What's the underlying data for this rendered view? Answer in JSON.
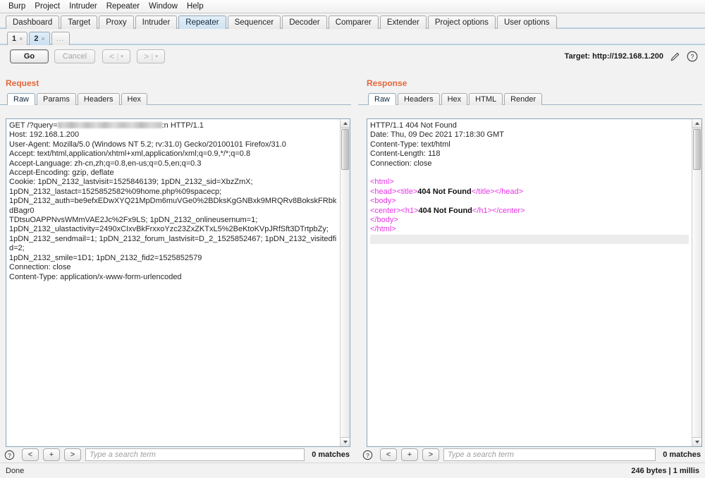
{
  "menubar": {
    "items": [
      "Burp",
      "Project",
      "Intruder",
      "Repeater",
      "Window",
      "Help"
    ]
  },
  "main_tabs": {
    "items": [
      "Dashboard",
      "Target",
      "Proxy",
      "Intruder",
      "Repeater",
      "Sequencer",
      "Decoder",
      "Comparer",
      "Extender",
      "Project options",
      "User options"
    ],
    "selected": "Repeater"
  },
  "repeater_tabs": {
    "items": [
      {
        "label": "1",
        "close": "×",
        "selected": false
      },
      {
        "label": "2",
        "close": "×",
        "selected": true
      },
      {
        "label": "...",
        "close": "",
        "selected": false
      }
    ]
  },
  "toolbar": {
    "go_label": "Go",
    "cancel_label": "Cancel",
    "back_label": "<",
    "forward_label": ">",
    "caret": "▾",
    "separator": "|",
    "target_label": "Target: http://192.168.1.200",
    "pencil_icon": "pencil-icon",
    "help_icon": "help-icon"
  },
  "request": {
    "title": "Request",
    "tabs": [
      "Raw",
      "Params",
      "Headers",
      "Hex"
    ],
    "selected_tab": "Raw",
    "lines": [
      {
        "prefix": "GET /?query=",
        "redacted": true,
        "suffix": ":n HTTP/1.1"
      },
      {
        "text": "Host: 192.168.1.200"
      },
      {
        "text": "User-Agent: Mozilla/5.0 (Windows NT 5.2; rv:31.0) Gecko/20100101 Firefox/31.0"
      },
      {
        "text": "Accept: text/html,application/xhtml+xml,application/xml;q=0.9,*/*;q=0.8"
      },
      {
        "text": "Accept-Language: zh-cn,zh;q=0.8,en-us;q=0.5,en;q=0.3"
      },
      {
        "text": "Accept-Encoding: gzip, deflate"
      },
      {
        "text": "Cookie: 1pDN_2132_lastvisit=1525846139; 1pDN_2132_sid=XbzZmX;"
      },
      {
        "text": "1pDN_2132_lastact=1525852582%09home.php%09spacecp;"
      },
      {
        "text": "1pDN_2132_auth=be9efxEDwXYQ21MpDm6muVGe0%2BDksKgGNBxk9MRQRv8BokskFRbkdBagr0"
      },
      {
        "text": "TDtsuOAPPNvsWMmVAE2Jc%2Fx9LS; 1pDN_2132_onlineusernum=1;"
      },
      {
        "text": "1pDN_2132_ulastactivity=2490xCIxvBkFrxxoYzc23ZxZKTxL5%2BeKtoKVpJRfSft3DTrtpbZy;"
      },
      {
        "text": "1pDN_2132_sendmail=1; 1pDN_2132_forum_lastvisit=D_2_1525852467; 1pDN_2132_visitedfid=2;"
      },
      {
        "text": "1pDN_2132_smile=1D1; 1pDN_2132_fid2=1525852579"
      },
      {
        "text": "Connection: close"
      },
      {
        "text": "Content-Type: application/x-www-form-urlencoded"
      }
    ],
    "search": {
      "help_icon": "help-icon",
      "prev_label": "<",
      "add_label": "+",
      "next_label": ">",
      "placeholder": "Type a search term",
      "value": "",
      "matches": "0 matches"
    }
  },
  "response": {
    "title": "Response",
    "tabs": [
      "Raw",
      "Headers",
      "Hex",
      "HTML",
      "Render"
    ],
    "selected_tab": "Raw",
    "header_lines": [
      "HTTP/1.1 404 Not Found",
      "Date: Thu, 09 Dec 2021 17:18:30 GMT",
      "Content-Type: text/html",
      "Content-Length: 118",
      "Connection: close"
    ],
    "body_lines": [
      [
        {
          "t": "tag",
          "v": "<html>"
        }
      ],
      [
        {
          "t": "tag",
          "v": "<head><title>"
        },
        {
          "t": "txt",
          "v": "404 Not Found"
        },
        {
          "t": "tag",
          "v": "</title></head>"
        }
      ],
      [
        {
          "t": "tag",
          "v": "<body>"
        }
      ],
      [
        {
          "t": "tag",
          "v": "<center><h1>"
        },
        {
          "t": "txt",
          "v": "404 Not Found"
        },
        {
          "t": "tag",
          "v": "</h1></center>"
        }
      ],
      [
        {
          "t": "tag",
          "v": "</body>"
        }
      ],
      [
        {
          "t": "tag",
          "v": "</html>"
        }
      ]
    ],
    "search": {
      "help_icon": "help-icon",
      "prev_label": "<",
      "add_label": "+",
      "next_label": ">",
      "placeholder": "Type a search term",
      "value": "",
      "matches": "0 matches"
    }
  },
  "statusbar": {
    "left": "Done",
    "right": "246 bytes | 1 millis"
  },
  "colors": {
    "accent_title": "#e4673b",
    "tag": "#e833e8",
    "tab_selected": "#cfe2f1",
    "panel_bg": "#f2f2f2"
  }
}
